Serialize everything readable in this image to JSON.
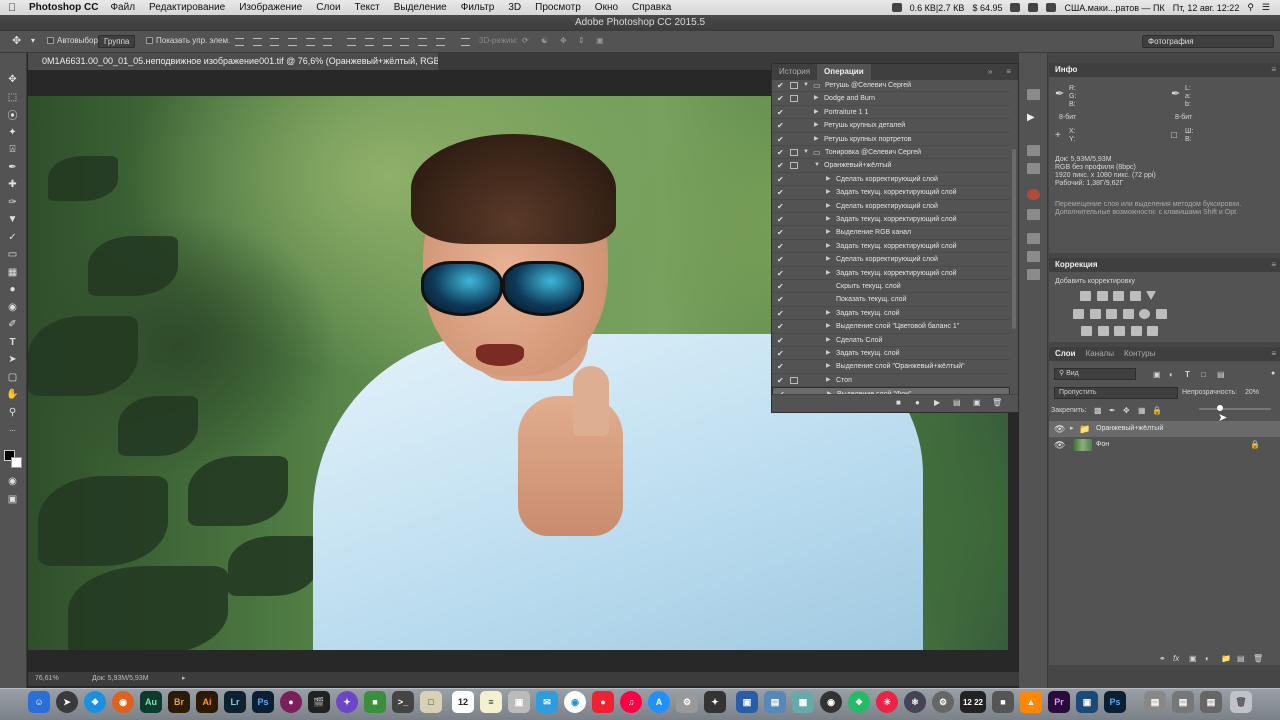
{
  "menubar": {
    "app": "Photoshop CC",
    "items": [
      "Файл",
      "Редактирование",
      "Изображение",
      "Слои",
      "Текст",
      "Выделение",
      "Фильтр",
      "3D",
      "Просмотр",
      "Окно",
      "Справка"
    ],
    "status_right": [
      "0.6 КВ|2.7 КВ",
      "$ 64.95",
      "",
      "США.маки...ратов — ПК",
      "Пт, 12 авг.  12:22"
    ]
  },
  "window_title": "Adobe Photoshop CC 2015.5",
  "options": {
    "autoselect_label": "Автовыбор:",
    "autoselect_value": "Группа",
    "show_transform_label": "Показать упр. элем.",
    "mode3d_label": "3D-режим:",
    "workspace": "Фотография"
  },
  "document": {
    "tab_title": "0M1A6631.00_00_01_05.неподвижное изображение001.tif @ 76,6% (Оранжевый+жёлтый, RGB/8#) *",
    "zoom": "76,61%",
    "doc_size": "Док: 5,93M/5,93M"
  },
  "actions_panel": {
    "tabs": [
      "История",
      "Операции"
    ],
    "active_tab": "Операции",
    "rows": [
      {
        "label": "Ретушь @Селевич Сергей",
        "indent": 1,
        "expanded": true,
        "dialog": true,
        "folder": true
      },
      {
        "label": "Dodge and Burn",
        "indent": 2,
        "expanded": false,
        "dialog": true,
        "folder": false
      },
      {
        "label": "Portraiture 1 1",
        "indent": 2,
        "expanded": false,
        "dialog": false,
        "folder": false
      },
      {
        "label": "Ретушь крупных деталей",
        "indent": 2,
        "expanded": false,
        "dialog": false,
        "folder": false
      },
      {
        "label": "Ретушь крупных портретов",
        "indent": 2,
        "expanded": false,
        "dialog": false,
        "folder": false
      },
      {
        "label": "Тонировка @Селевич Сергей",
        "indent": 1,
        "expanded": true,
        "dialog": true,
        "folder": true
      },
      {
        "label": "Оранжевый+жёлтый",
        "indent": 2,
        "expanded": true,
        "dialog": true,
        "folder": false
      },
      {
        "label": "Сделать корректирующий слой",
        "indent": 3,
        "expanded": false,
        "dialog": false,
        "folder": false
      },
      {
        "label": "Задать текущ. корректирующий слой",
        "indent": 3,
        "expanded": false,
        "dialog": false,
        "folder": false
      },
      {
        "label": "Сделать корректирующий слой",
        "indent": 3,
        "expanded": false,
        "dialog": false,
        "folder": false
      },
      {
        "label": "Задать текущ. корректирующий слой",
        "indent": 3,
        "expanded": false,
        "dialog": false,
        "folder": false
      },
      {
        "label": "Выделение RGB канал",
        "indent": 3,
        "expanded": false,
        "dialog": false,
        "folder": false
      },
      {
        "label": "Задать текущ. корректирующий слой",
        "indent": 3,
        "expanded": false,
        "dialog": false,
        "folder": false
      },
      {
        "label": "Сделать корректирующий слой",
        "indent": 3,
        "expanded": false,
        "dialog": false,
        "folder": false
      },
      {
        "label": "Задать текущ. корректирующий слой",
        "indent": 3,
        "expanded": false,
        "dialog": false,
        "folder": false
      },
      {
        "label": "Скрыть текущ. слой",
        "indent": 3,
        "expanded": null,
        "dialog": false,
        "folder": false
      },
      {
        "label": "Показать текущ. слой",
        "indent": 3,
        "expanded": null,
        "dialog": false,
        "folder": false
      },
      {
        "label": "Задать текущ. слой",
        "indent": 3,
        "expanded": false,
        "dialog": false,
        "folder": false
      },
      {
        "label": "Выделение слой \"Цветовой баланс 1\"",
        "indent": 3,
        "expanded": false,
        "dialog": false,
        "folder": false
      },
      {
        "label": "Сделать Слой",
        "indent": 3,
        "expanded": false,
        "dialog": false,
        "folder": false
      },
      {
        "label": "Задать текущ. слой",
        "indent": 3,
        "expanded": false,
        "dialog": false,
        "folder": false
      },
      {
        "label": "Выделение слой \"Оранжевый+жёлтый\"",
        "indent": 3,
        "expanded": false,
        "dialog": false,
        "folder": false
      },
      {
        "label": "Стоп",
        "indent": 3,
        "expanded": false,
        "dialog": true,
        "folder": false
      },
      {
        "label": "Выделение слой \"Фон\"",
        "indent": 3,
        "expanded": false,
        "dialog": false,
        "folder": false,
        "selected": true
      }
    ]
  },
  "info_panel": {
    "title": "Инфо",
    "rgb_labels": [
      "R:",
      "G:",
      "B:"
    ],
    "lab_labels": [
      "L:",
      "a:",
      "b:"
    ],
    "bitdepth_left": "8-бит",
    "bitdepth_right": "8-бит",
    "xy_labels": [
      "X:",
      "Y:"
    ],
    "wh_labels": [
      "Ш:",
      "В:"
    ],
    "doc_lines": [
      "Док: 5,93M/5,93M",
      "RGB без профиля (8bpc)",
      "1920 пикс. x 1080 пикс. (72 ppi)",
      "Рабочий: 1,38Г/9,62Г"
    ],
    "hint_lines": [
      "Перемещение слоя или выделения методом буксировки.",
      "Дополнительные возможности: с клавишами Shift и Opt."
    ]
  },
  "adjustments_panel": {
    "title": "Коррекция",
    "subtitle": "Добавить корректировку"
  },
  "layers_panel": {
    "tabs": [
      "Слои",
      "Каналы",
      "Контуры"
    ],
    "filter_label": "Вид",
    "blend_mode": "Пропустить",
    "opacity_label": "Непрозрачность:",
    "opacity_value": "20%",
    "lock_label": "Закрепить:",
    "layers": [
      {
        "name": "Оранжевый+жёлтый",
        "type": "group"
      },
      {
        "name": "Фон",
        "type": "image",
        "locked": true
      }
    ]
  },
  "dock": {
    "calendar_day": "12",
    "clock": "12 22",
    "apps": [
      "Au",
      "Br",
      "Ai",
      "Lr",
      "Ps",
      "Pr",
      "Ps"
    ]
  }
}
